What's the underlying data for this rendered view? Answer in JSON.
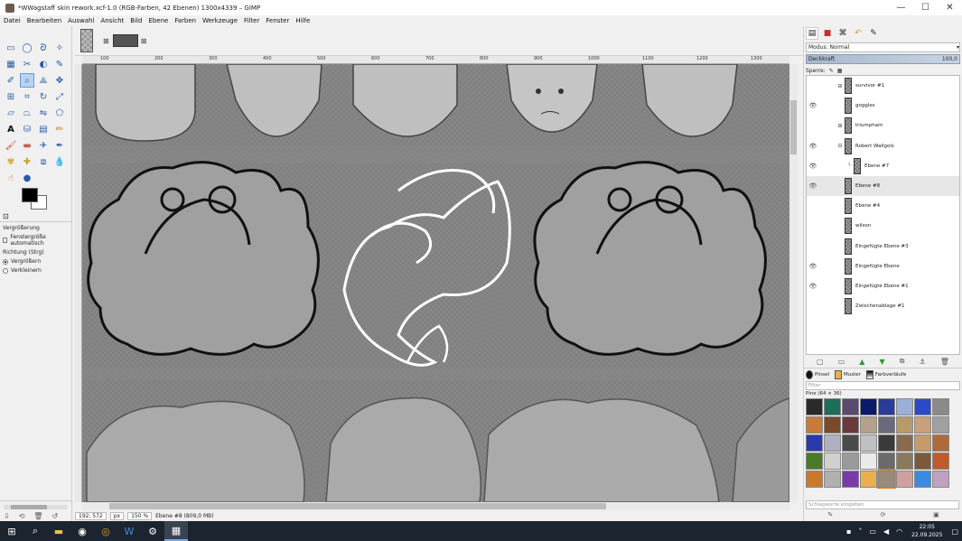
{
  "window": {
    "title": "*WWagstaff skin rework.xcf-1.0 (RGB-Farben, 42 Ebenen) 1300x4339 – GIMP",
    "minimize": "—",
    "maximize": "☐",
    "close": "✕"
  },
  "menu": [
    "Datei",
    "Bearbeiten",
    "Auswahl",
    "Ansicht",
    "Bild",
    "Ebene",
    "Farben",
    "Werkzeuge",
    "Filter",
    "Fenster",
    "Hilfe"
  ],
  "tool_options": {
    "title": "Vergrößerung",
    "auto_resize": "Fenstergröße automatisch",
    "direction_label": "Richtung (Strg)",
    "option_in": "Vergrößern",
    "option_out": "Verkleinern"
  },
  "ruler": {
    "ticks": [
      "100",
      "200",
      "300",
      "400",
      "500",
      "600",
      "700",
      "800",
      "900",
      "1000",
      "1100",
      "1200",
      "1300"
    ]
  },
  "statusbar": {
    "coords": "192, 572",
    "unit": "px",
    "zoom": "150 %",
    "message": "Ebene #8 (809,0 MB)"
  },
  "layers_panel": {
    "mode_label": "Modus",
    "mode_value": "Normal",
    "opacity_label": "Deckkraft",
    "opacity_value": "100,0",
    "lock_label": "Sperre:",
    "layers": [
      {
        "name": "survivor #1",
        "visible": false,
        "expander": "⊞",
        "indent": 0
      },
      {
        "name": "goggles",
        "visible": true,
        "expander": "",
        "indent": 0
      },
      {
        "name": "triumpham",
        "visible": false,
        "expander": "⊞",
        "indent": 0
      },
      {
        "name": "Robert Wallgols",
        "visible": true,
        "expander": "⊟",
        "indent": 0
      },
      {
        "name": "Ebene #7",
        "visible": true,
        "expander": "",
        "indent": 1
      },
      {
        "name": "Ebene #8",
        "visible": true,
        "expander": "",
        "indent": 0
      },
      {
        "name": "Ebene #4",
        "visible": false,
        "expander": "",
        "indent": 0
      },
      {
        "name": "wilson",
        "visible": false,
        "expander": "",
        "indent": 0
      },
      {
        "name": "Eingefügte Ebene #3",
        "visible": false,
        "expander": "",
        "indent": 0
      },
      {
        "name": "Eingefügte Ebene",
        "visible": true,
        "expander": "",
        "indent": 0
      },
      {
        "name": "Eingefügte Ebene #1",
        "visible": true,
        "expander": "",
        "indent": 0
      },
      {
        "name": "Zwischenablage #1",
        "visible": false,
        "expander": "",
        "indent": 0
      }
    ]
  },
  "brushes_panel": {
    "tabs": [
      "Pinsel",
      "Muster",
      "Farbverläufe"
    ],
    "filter_placeholder": "Filter",
    "pattern_label": "Pine (64 × 36)",
    "tag_placeholder": "Schlagworte eingeben",
    "swatches": [
      "#2a2a2a",
      "#1d6e5b",
      "#5a4b6e",
      "#0b1a6a",
      "#2b3b9a",
      "#9ab0d8",
      "#2b4ac8",
      "#8a8a8a",
      "#c87a3a",
      "#7a4a2a",
      "#6a3a3a",
      "#b5a08a",
      "#6a6a7a",
      "#b89a6a",
      "#c8a07a",
      "#a0a0a0",
      "#2a3aaa",
      "#b0b0c0",
      "#4a4a4a",
      "#c0c0c0",
      "#3a3a3a",
      "#8a6a4a",
      "#c89a6a",
      "#b06a3a",
      "#4a7a2a",
      "#d0d0d0",
      "#9a9a9a",
      "#eaeaea",
      "#6a6a6a",
      "#8a7a5a",
      "#7a5a3a",
      "#c05a2a",
      "#c87a2a",
      "#b0b0b0",
      "#7a3aaa",
      "#eab050",
      "#9a8a7a",
      "#d0a0a0",
      "#3a8ae0",
      "#c0a0c0"
    ]
  },
  "taskbar": {
    "clock_time": "22:05",
    "clock_date": "22.09.2025"
  }
}
